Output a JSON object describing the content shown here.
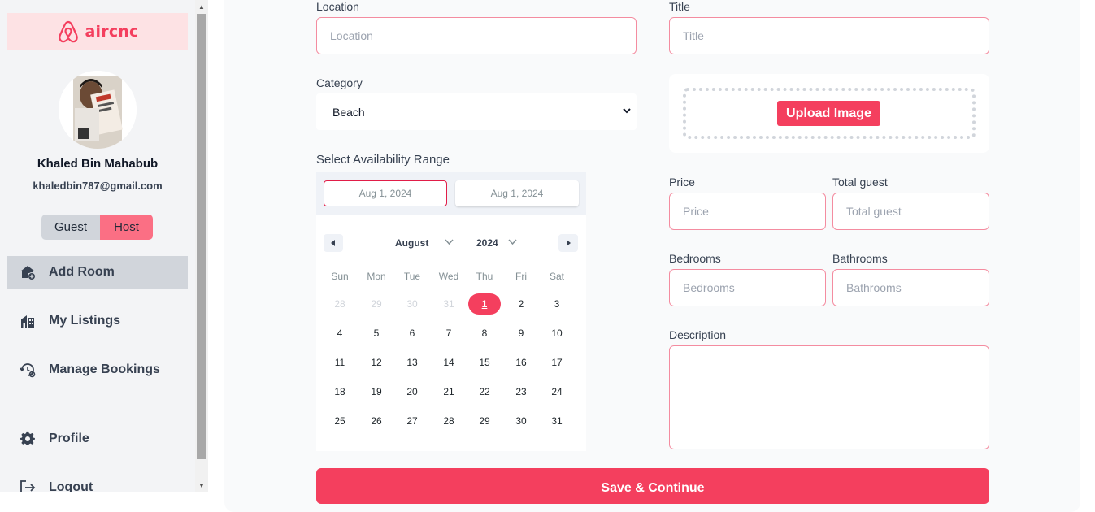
{
  "brand": {
    "name": "aircnc",
    "color": "#f43f5e"
  },
  "user": {
    "name": "Khaled Bin Mahabub",
    "email": "khaledbin787@gmail.com"
  },
  "role_toggle": {
    "guest": "Guest",
    "host": "Host",
    "active": "Host"
  },
  "nav": {
    "add_room": "Add Room",
    "my_listings": "My Listings",
    "manage_bookings": "Manage Bookings",
    "profile": "Profile",
    "logout": "Logout"
  },
  "form": {
    "location_label": "Location",
    "location_placeholder": "Location",
    "title_label": "Title",
    "title_placeholder": "Title",
    "category_label": "Category",
    "category_value": "Beach",
    "upload_button": "Upload Image",
    "range_title": "Select Availability Range",
    "price_label": "Price",
    "price_placeholder": "Price",
    "guest_label": "Total guest",
    "guest_placeholder": "Total guest",
    "bedrooms_label": "Bedrooms",
    "bedrooms_placeholder": "Bedrooms",
    "bathrooms_label": "Bathrooms",
    "bathrooms_placeholder": "Bathrooms",
    "description_label": "Description",
    "description_value": "",
    "save_button": "Save & Continue"
  },
  "calendar": {
    "start_date": "Aug 1, 2024",
    "end_date": "Aug 1, 2024",
    "month": "August",
    "year": "2024",
    "weekdays": [
      "Sun",
      "Mon",
      "Tue",
      "Wed",
      "Thu",
      "Fri",
      "Sat"
    ],
    "weeks": [
      [
        "28",
        "29",
        "30",
        "31",
        "1",
        "2",
        "3"
      ],
      [
        "4",
        "5",
        "6",
        "7",
        "8",
        "9",
        "10"
      ],
      [
        "11",
        "12",
        "13",
        "14",
        "15",
        "16",
        "17"
      ],
      [
        "18",
        "19",
        "20",
        "21",
        "22",
        "23",
        "24"
      ],
      [
        "25",
        "26",
        "27",
        "28",
        "29",
        "30",
        "31"
      ]
    ],
    "selected_day": "1",
    "selected_color": "#f43f5e"
  }
}
